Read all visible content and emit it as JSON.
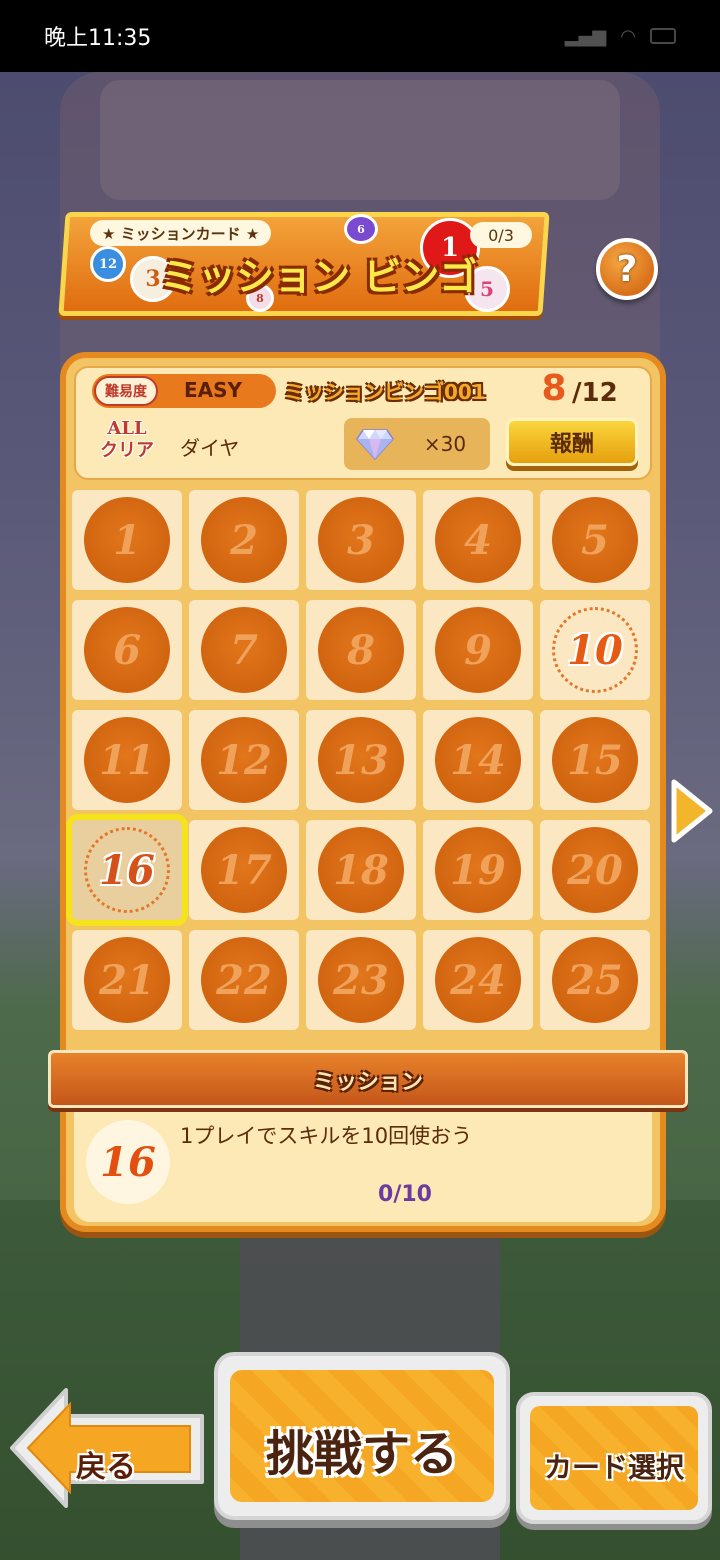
{
  "status_bar": {
    "time": "晚上11:35"
  },
  "header": {
    "tag": "★ ミッションカード ★",
    "title": "ミッション ビンゴ",
    "card_count": "0/3",
    "help_symbol": "?"
  },
  "info": {
    "difficulty_label": "難易度",
    "difficulty_value": "EASY",
    "bingo_name": "ミッションビンゴ001",
    "progress_current": "8",
    "progress_total": "/12",
    "allclear_label_1": "ALL",
    "allclear_label_2": "クリア",
    "reward_name": "ダイヤ",
    "reward_icon": "diamond-icon",
    "reward_qty": "×30",
    "reward_button": "報酬"
  },
  "grid": {
    "cells": [
      "1",
      "2",
      "3",
      "4",
      "5",
      "6",
      "7",
      "8",
      "9",
      "10",
      "11",
      "12",
      "13",
      "14",
      "15",
      "16",
      "17",
      "18",
      "19",
      "20",
      "21",
      "22",
      "23",
      "24",
      "25"
    ],
    "completed": [
      "10",
      "16"
    ],
    "selected": "16"
  },
  "mission": {
    "label": "ミッション",
    "number": "16",
    "description": "1プレイでスキルを10回使おう",
    "progress": "0/10"
  },
  "buttons": {
    "back": "戻る",
    "challenge": "挑戦する",
    "card_select": "カード選択"
  },
  "colors": {
    "panel": "#f3c464",
    "disc": "#d0630f",
    "highlight": "#f5e41c",
    "accent": "#e8591c"
  }
}
